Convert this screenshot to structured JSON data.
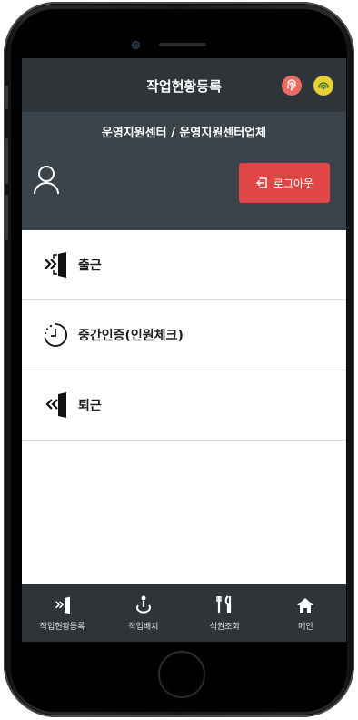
{
  "header": {
    "title": "작업현황등록"
  },
  "status_icons": [
    {
      "name": "fingerprint-icon",
      "color": "#ee6b62"
    },
    {
      "name": "signal-icon",
      "color": "#e8cf34"
    }
  ],
  "info": {
    "organization": "운영지원센터 / 운영지원센터업체",
    "logout_label": "로그아웃"
  },
  "menu": {
    "items": [
      {
        "label": "출근",
        "icon": "enter-door-icon"
      },
      {
        "label": "중간인증(인원체크)",
        "icon": "timer-icon"
      },
      {
        "label": "퇴근",
        "icon": "exit-door-icon"
      }
    ]
  },
  "tabbar": {
    "items": [
      {
        "label": "작업현황등록",
        "icon": "enter-door-icon"
      },
      {
        "label": "작업배치",
        "icon": "placement-icon"
      },
      {
        "label": "식권조회",
        "icon": "utensils-icon"
      },
      {
        "label": "메인",
        "icon": "home-icon"
      }
    ]
  },
  "colors": {
    "topbar": "#2e3438",
    "infobar": "#3c444b",
    "logout": "#e04646"
  }
}
